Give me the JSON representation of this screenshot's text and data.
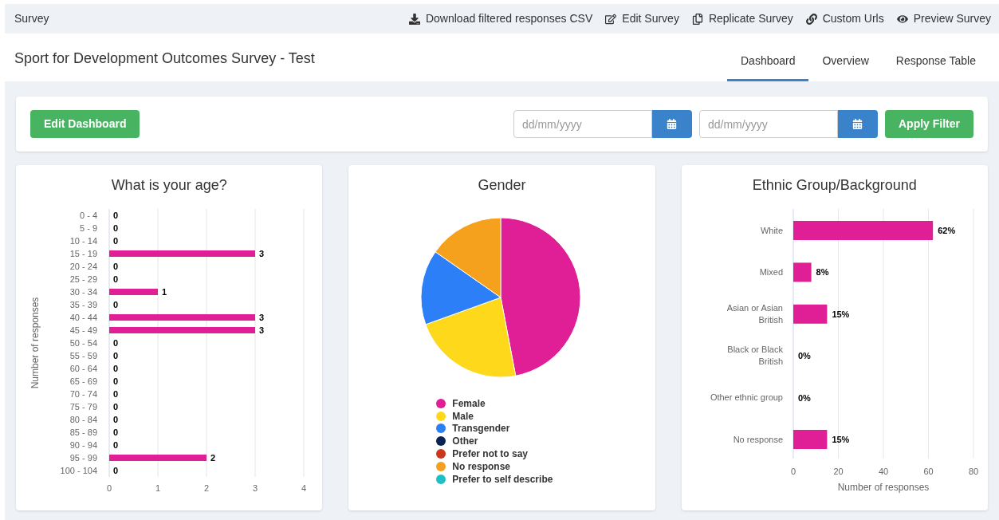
{
  "top_bar": {
    "title": "Survey",
    "actions": [
      {
        "label": "Download filtered responses CSV",
        "kind": "download"
      },
      {
        "label": "Edit Survey",
        "kind": "edit"
      },
      {
        "label": "Replicate Survey",
        "kind": "copy"
      },
      {
        "label": "Custom Urls",
        "kind": "link"
      },
      {
        "label": "Preview Survey",
        "kind": "preview"
      }
    ]
  },
  "header": {
    "title": "Sport for Development Outcomes Survey - Test",
    "tabs": [
      {
        "label": "Dashboard",
        "selected": true
      },
      {
        "label": "Overview",
        "selected": false
      },
      {
        "label": "Response Table",
        "selected": false
      }
    ]
  },
  "filter_bar": {
    "edit_button": "Edit Dashboard",
    "date_from": {
      "placeholder": "dd/mm/yyyy"
    },
    "date_to": {
      "placeholder": "dd/mm/yyyy"
    },
    "apply_button": "Apply Filter"
  },
  "age_chart": {
    "chart_data": {
      "type": "bar",
      "orientation": "horizontal",
      "title": "What is your age?",
      "ylabel": "Number of responses",
      "categories": [
        "0 - 4",
        "5 - 9",
        "10 - 14",
        "15 - 19",
        "20 - 24",
        "25 - 29",
        "30 - 34",
        "35 - 39",
        "40 - 44",
        "45 - 49",
        "50 - 54",
        "55 - 59",
        "60 - 64",
        "65 - 69",
        "70 - 74",
        "75 - 79",
        "80 - 84",
        "85 - 89",
        "90 - 94",
        "95 - 99",
        "100 - 104"
      ],
      "series": [
        {
          "color": "#e01e95",
          "values": [
            0,
            0,
            0,
            3,
            0,
            0,
            1,
            0,
            3,
            3,
            0,
            0,
            0,
            0,
            0,
            0,
            0,
            0,
            0,
            2,
            0
          ]
        }
      ],
      "xlim": [
        0,
        4
      ],
      "xticks": [
        0,
        1,
        2,
        3,
        4
      ],
      "grid": true,
      "data_labels": true
    }
  },
  "gender_chart": {
    "title": "Gender",
    "legend": [
      {
        "label": "Female",
        "color": "#e01e95"
      },
      {
        "label": "Male",
        "color": "#fed81a"
      },
      {
        "label": "Transgender",
        "color": "#2c7ff7"
      },
      {
        "label": "Other",
        "color": "#0a2355"
      },
      {
        "label": "Prefer not to say",
        "color": "#c9381a"
      },
      {
        "label": "No response",
        "color": "#f5a11e"
      },
      {
        "label": "Prefer to self describe",
        "color": "#1fc0c5"
      }
    ]
  },
  "ethnic_chart": {
    "chart_data": {
      "type": "bar",
      "orientation": "horizontal",
      "title": "Ethnic Group/Background",
      "xlabel": "Number of responses",
      "categories": [
        "White",
        "Mixed",
        "Asian or Asian British",
        "Black or Black British",
        "Other ethnic group",
        "No response"
      ],
      "series": [
        {
          "color": "#e01e95",
          "values": [
            62,
            8,
            15,
            0,
            0,
            15
          ]
        }
      ],
      "xlim": [
        0,
        80
      ],
      "xticks": [
        0,
        20,
        40,
        60,
        80
      ],
      "grid": true,
      "value_labels": [
        "62%",
        "8%",
        "15%",
        "0%",
        "0%",
        "15%"
      ]
    }
  }
}
